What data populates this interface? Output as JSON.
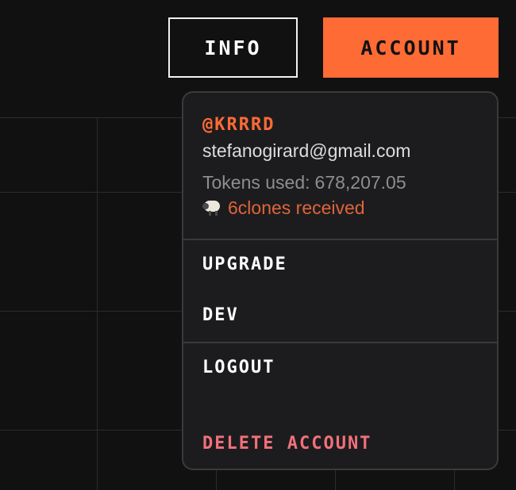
{
  "header": {
    "info_label": "INFO",
    "account_label": "ACCOUNT"
  },
  "account_menu": {
    "handle": "@KRRRD",
    "email": "stefanogirard@gmail.com",
    "tokens_label": "Tokens used:",
    "tokens_value": "678,207.05",
    "clones_icon": "sheep-icon",
    "clones_text": "6clones received",
    "items": [
      {
        "label": "UPGRADE"
      },
      {
        "label": "DEV"
      },
      {
        "label": "LOGOUT"
      },
      {
        "label": "DELETE ACCOUNT"
      }
    ]
  },
  "colors": {
    "accent": "#ff6b35",
    "background": "#111111",
    "menu_bg": "#1c1c1e",
    "danger": "#f2707a",
    "clones_text": "#e0643a"
  }
}
